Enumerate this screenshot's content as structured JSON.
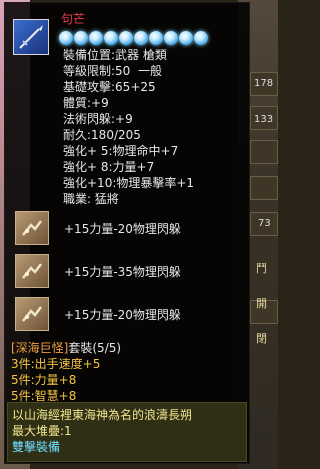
{
  "item": {
    "name": "句芒",
    "stars_count": 10,
    "stats": [
      "裝備位置:武器 槍類",
      "等級限制:50  一般",
      "基礎攻擊:65+25",
      "體質:+9",
      "法術閃躲:+9",
      "耐久:180/205",
      "強化+ 5:物理命中+7",
      "強化+ 8:力量+7",
      "強化+10:物理暴擊率+1",
      "職業: 猛將"
    ]
  },
  "gems": [
    {
      "text": "+15力量-20物理閃躲"
    },
    {
      "text": "+15力量-35物理閃躲"
    },
    {
      "text": "+15力量-20物理閃躲"
    }
  ],
  "set": {
    "name": "[深海巨怪]",
    "suffix": "套裝(5/5)",
    "bonuses": [
      "3件:出手速度+5",
      "5件:力量+8",
      "5件:智慧+8"
    ]
  },
  "description": {
    "line1": "以山海經裡東海神為名的浪濤長朔",
    "line2": "最大堆疊:1",
    "line3": "雙擊裝備"
  },
  "background": {
    "numbers": [
      "178",
      "133",
      "73"
    ],
    "labels": [
      "鬥",
      "開",
      "閉"
    ]
  }
}
